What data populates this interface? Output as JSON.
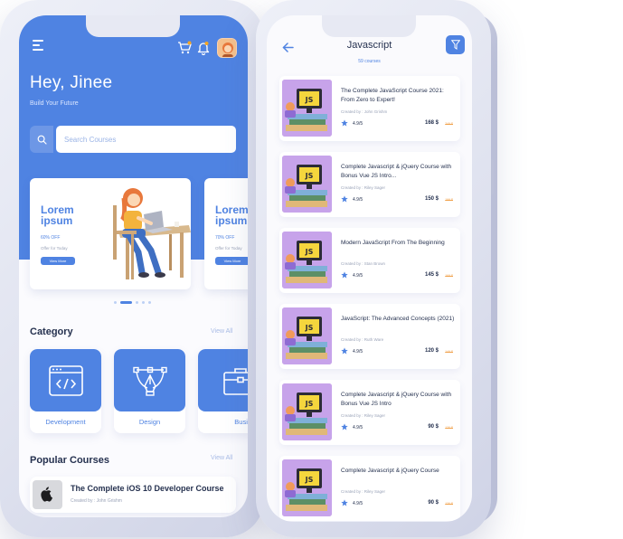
{
  "home": {
    "greeting": "Hey, Jinee",
    "tagline": "Build Your Future",
    "search_placeholder": "Search Courses",
    "promos": [
      {
        "title": "Lorem ipsum",
        "discount": "60% OFF",
        "offer": "Offer for Today",
        "button": "View More"
      },
      {
        "title": "Lorem ipsum",
        "discount": "70% OFF",
        "offer": "Offer for Today",
        "button": "View More"
      }
    ],
    "category_title": "Category",
    "category_view_all": "View All",
    "categories": [
      {
        "label": "Development",
        "icon": "code-window-icon"
      },
      {
        "label": "Design",
        "icon": "pen-tool-icon"
      },
      {
        "label": "Business",
        "icon": "briefcase-icon"
      }
    ],
    "popular_title": "Popular Courses",
    "popular_view_all": "View All",
    "popular": [
      {
        "title": "The Complete iOS 10 Developer Course",
        "author": "Created by : John Grishm"
      }
    ]
  },
  "list": {
    "title": "Javascript",
    "count": "59 courses",
    "courses": [
      {
        "title": "The Complete JavaScript Course 2021: From Zero to Expert!",
        "author": "Created by : John Grishm",
        "rating": "4.9/5",
        "price": "168 $",
        "old_price": "249 $"
      },
      {
        "title": "Complete Javascript & jQuery Course with Bonus Vue JS Intro...",
        "author": "Created by : Riley Sager",
        "rating": "4.9/5",
        "price": "150 $",
        "old_price": "199 $"
      },
      {
        "title": "Modern JavaScript From The Beginning",
        "author": "Created by : Stan Brown",
        "rating": "4.9/5",
        "price": "145 $",
        "old_price": "169 $"
      },
      {
        "title": "JavaScript: The Advanced Concepts (2021)",
        "author": "Created by : Ruth Ware",
        "rating": "4.9/5",
        "price": "120 $",
        "old_price": "149 $"
      },
      {
        "title": "Complete Javascript & jQuery Course with Bonus Vue JS Intro",
        "author": "Created by : Riley Sager",
        "rating": "4.9/5",
        "price": "90 $",
        "old_price": "120 $"
      },
      {
        "title": "Complete Javascript & jQuery Course",
        "author": "Created by : Riley Sager",
        "rating": "4.9/5",
        "price": "90 $",
        "old_price": "120 $"
      }
    ]
  },
  "colors": {
    "primary": "#4f83e2",
    "thumb": "#c7a3ea",
    "old_price": "#f0a24d"
  }
}
